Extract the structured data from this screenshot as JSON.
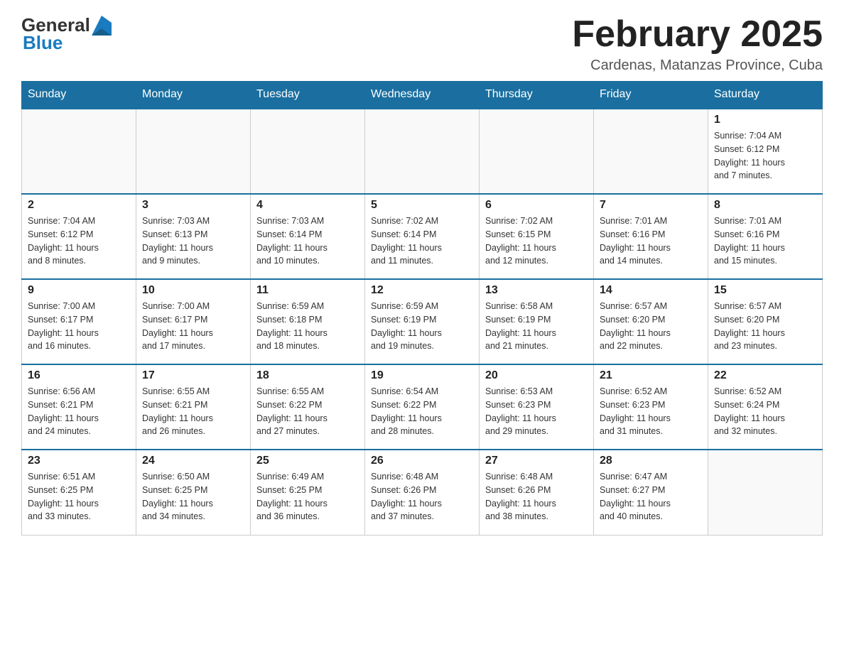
{
  "header": {
    "logo_general": "General",
    "logo_blue": "Blue",
    "month_title": "February 2025",
    "subtitle": "Cardenas, Matanzas Province, Cuba"
  },
  "days_of_week": [
    "Sunday",
    "Monday",
    "Tuesday",
    "Wednesday",
    "Thursday",
    "Friday",
    "Saturday"
  ],
  "weeks": [
    [
      {
        "day": "",
        "info": ""
      },
      {
        "day": "",
        "info": ""
      },
      {
        "day": "",
        "info": ""
      },
      {
        "day": "",
        "info": ""
      },
      {
        "day": "",
        "info": ""
      },
      {
        "day": "",
        "info": ""
      },
      {
        "day": "1",
        "info": "Sunrise: 7:04 AM\nSunset: 6:12 PM\nDaylight: 11 hours\nand 7 minutes."
      }
    ],
    [
      {
        "day": "2",
        "info": "Sunrise: 7:04 AM\nSunset: 6:12 PM\nDaylight: 11 hours\nand 8 minutes."
      },
      {
        "day": "3",
        "info": "Sunrise: 7:03 AM\nSunset: 6:13 PM\nDaylight: 11 hours\nand 9 minutes."
      },
      {
        "day": "4",
        "info": "Sunrise: 7:03 AM\nSunset: 6:14 PM\nDaylight: 11 hours\nand 10 minutes."
      },
      {
        "day": "5",
        "info": "Sunrise: 7:02 AM\nSunset: 6:14 PM\nDaylight: 11 hours\nand 11 minutes."
      },
      {
        "day": "6",
        "info": "Sunrise: 7:02 AM\nSunset: 6:15 PM\nDaylight: 11 hours\nand 12 minutes."
      },
      {
        "day": "7",
        "info": "Sunrise: 7:01 AM\nSunset: 6:16 PM\nDaylight: 11 hours\nand 14 minutes."
      },
      {
        "day": "8",
        "info": "Sunrise: 7:01 AM\nSunset: 6:16 PM\nDaylight: 11 hours\nand 15 minutes."
      }
    ],
    [
      {
        "day": "9",
        "info": "Sunrise: 7:00 AM\nSunset: 6:17 PM\nDaylight: 11 hours\nand 16 minutes."
      },
      {
        "day": "10",
        "info": "Sunrise: 7:00 AM\nSunset: 6:17 PM\nDaylight: 11 hours\nand 17 minutes."
      },
      {
        "day": "11",
        "info": "Sunrise: 6:59 AM\nSunset: 6:18 PM\nDaylight: 11 hours\nand 18 minutes."
      },
      {
        "day": "12",
        "info": "Sunrise: 6:59 AM\nSunset: 6:19 PM\nDaylight: 11 hours\nand 19 minutes."
      },
      {
        "day": "13",
        "info": "Sunrise: 6:58 AM\nSunset: 6:19 PM\nDaylight: 11 hours\nand 21 minutes."
      },
      {
        "day": "14",
        "info": "Sunrise: 6:57 AM\nSunset: 6:20 PM\nDaylight: 11 hours\nand 22 minutes."
      },
      {
        "day": "15",
        "info": "Sunrise: 6:57 AM\nSunset: 6:20 PM\nDaylight: 11 hours\nand 23 minutes."
      }
    ],
    [
      {
        "day": "16",
        "info": "Sunrise: 6:56 AM\nSunset: 6:21 PM\nDaylight: 11 hours\nand 24 minutes."
      },
      {
        "day": "17",
        "info": "Sunrise: 6:55 AM\nSunset: 6:21 PM\nDaylight: 11 hours\nand 26 minutes."
      },
      {
        "day": "18",
        "info": "Sunrise: 6:55 AM\nSunset: 6:22 PM\nDaylight: 11 hours\nand 27 minutes."
      },
      {
        "day": "19",
        "info": "Sunrise: 6:54 AM\nSunset: 6:22 PM\nDaylight: 11 hours\nand 28 minutes."
      },
      {
        "day": "20",
        "info": "Sunrise: 6:53 AM\nSunset: 6:23 PM\nDaylight: 11 hours\nand 29 minutes."
      },
      {
        "day": "21",
        "info": "Sunrise: 6:52 AM\nSunset: 6:23 PM\nDaylight: 11 hours\nand 31 minutes."
      },
      {
        "day": "22",
        "info": "Sunrise: 6:52 AM\nSunset: 6:24 PM\nDaylight: 11 hours\nand 32 minutes."
      }
    ],
    [
      {
        "day": "23",
        "info": "Sunrise: 6:51 AM\nSunset: 6:25 PM\nDaylight: 11 hours\nand 33 minutes."
      },
      {
        "day": "24",
        "info": "Sunrise: 6:50 AM\nSunset: 6:25 PM\nDaylight: 11 hours\nand 34 minutes."
      },
      {
        "day": "25",
        "info": "Sunrise: 6:49 AM\nSunset: 6:25 PM\nDaylight: 11 hours\nand 36 minutes."
      },
      {
        "day": "26",
        "info": "Sunrise: 6:48 AM\nSunset: 6:26 PM\nDaylight: 11 hours\nand 37 minutes."
      },
      {
        "day": "27",
        "info": "Sunrise: 6:48 AM\nSunset: 6:26 PM\nDaylight: 11 hours\nand 38 minutes."
      },
      {
        "day": "28",
        "info": "Sunrise: 6:47 AM\nSunset: 6:27 PM\nDaylight: 11 hours\nand 40 minutes."
      },
      {
        "day": "",
        "info": ""
      }
    ]
  ]
}
